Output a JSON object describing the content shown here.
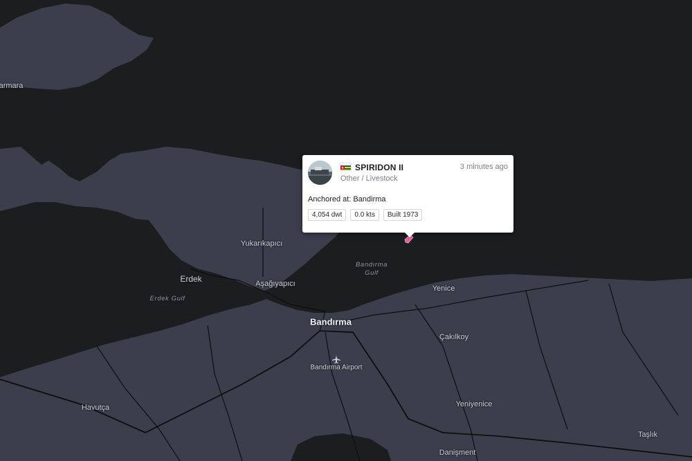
{
  "map": {
    "places": [
      {
        "id": "marmara",
        "label": "armara",
        "kind": "town"
      },
      {
        "id": "yukarikapici",
        "label": "Yukarıkapıcı",
        "kind": "town"
      },
      {
        "id": "erdek",
        "label": "Erdek",
        "kind": "town"
      },
      {
        "id": "asagiyapici",
        "label": "Aşağıyapıcı",
        "kind": "town"
      },
      {
        "id": "bandirma",
        "label": "Bandırma",
        "kind": "city"
      },
      {
        "id": "yenice",
        "label": "Yenice",
        "kind": "town"
      },
      {
        "id": "cakilkoy",
        "label": "Çakılkoy",
        "kind": "town"
      },
      {
        "id": "havutca",
        "label": "Havutça",
        "kind": "town"
      },
      {
        "id": "yeniyenice",
        "label": "Yeniyenice",
        "kind": "town"
      },
      {
        "id": "danisment",
        "label": "Danişment",
        "kind": "town"
      },
      {
        "id": "taslik",
        "label": "Taşlık",
        "kind": "town"
      }
    ],
    "water_labels": [
      {
        "id": "bandirma-gulf",
        "label": "Bandırma\nGulf"
      },
      {
        "id": "erdek-gulf",
        "label": "Erdek Gulf"
      }
    ],
    "poi": {
      "label": "Bandırma Airport",
      "icon": "airport-icon"
    },
    "colors": {
      "water": "#1c1d1f",
      "land": "#3b3f4c",
      "road": "#0d0e10",
      "marker": "#e0609a"
    }
  },
  "vessel_popup": {
    "name": "SPIRIDON II",
    "type": "Other / Livestock",
    "time_ago": "3 minutes ago",
    "status": "Anchored at: Bandirma",
    "flag_icon": "togo-flag-icon",
    "tags": [
      "4,054 dwt",
      "0.0 kts",
      "Built 1973"
    ]
  }
}
